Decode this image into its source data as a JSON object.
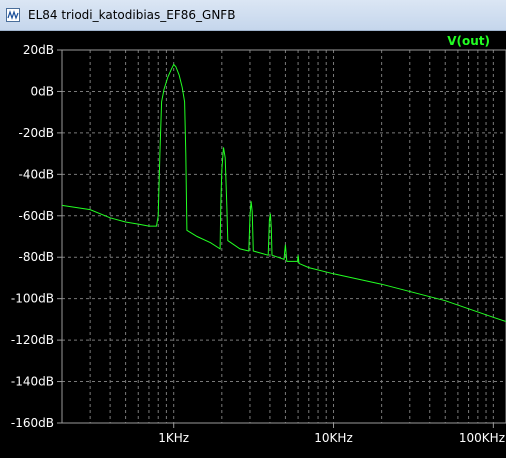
{
  "window": {
    "title": "EL84 triodi_katodibias_EF86_GNFB"
  },
  "chart_data": {
    "type": "line",
    "x_scale": "log",
    "xlim_hz": [
      200,
      120000
    ],
    "ylim_db": [
      -160,
      20
    ],
    "y_tick_values": [
      20,
      0,
      -20,
      -40,
      -60,
      -80,
      -100,
      -120,
      -140,
      -160
    ],
    "y_tick_labels": [
      "20dB",
      "0dB",
      "-20dB",
      "-40dB",
      "-60dB",
      "-80dB",
      "-100dB",
      "-120dB",
      "-140dB",
      "-160dB"
    ],
    "x_tick_values": [
      1000,
      10000,
      100000
    ],
    "x_tick_labels": [
      "1KHz",
      "10KHz",
      "100KHz"
    ],
    "grid": true,
    "colors": {
      "background": "#000000",
      "axes": "#9a9a9a",
      "grid": "#7a7a7a",
      "trace": "#22ff22"
    },
    "series": [
      {
        "name": "V(out)",
        "points": [
          [
            200,
            -55
          ],
          [
            300,
            -57
          ],
          [
            400,
            -61
          ],
          [
            500,
            -63
          ],
          [
            600,
            -64
          ],
          [
            700,
            -65
          ],
          [
            780,
            -65
          ],
          [
            800,
            -60
          ],
          [
            820,
            -30
          ],
          [
            840,
            -5
          ],
          [
            870,
            1
          ],
          [
            920,
            7
          ],
          [
            970,
            11
          ],
          [
            1000,
            13
          ],
          [
            1030,
            12
          ],
          [
            1080,
            8
          ],
          [
            1130,
            2
          ],
          [
            1170,
            -5
          ],
          [
            1190,
            -30
          ],
          [
            1210,
            -67
          ],
          [
            1400,
            -70
          ],
          [
            1700,
            -73
          ],
          [
            1950,
            -76
          ],
          [
            1970,
            -55
          ],
          [
            2000,
            -38
          ],
          [
            2050,
            -27
          ],
          [
            2100,
            -32
          ],
          [
            2150,
            -55
          ],
          [
            2180,
            -72
          ],
          [
            2600,
            -76
          ],
          [
            2950,
            -77
          ],
          [
            3000,
            -60
          ],
          [
            3050,
            -53
          ],
          [
            3100,
            -58
          ],
          [
            3150,
            -77
          ],
          [
            3900,
            -79
          ],
          [
            3970,
            -62
          ],
          [
            4030,
            -59
          ],
          [
            4080,
            -66
          ],
          [
            4120,
            -79
          ],
          [
            4900,
            -81
          ],
          [
            5000,
            -74
          ],
          [
            5100,
            -82
          ],
          [
            5950,
            -82
          ],
          [
            6000,
            -79
          ],
          [
            6080,
            -83
          ],
          [
            7000,
            -85
          ],
          [
            10000,
            -88
          ],
          [
            20000,
            -93
          ],
          [
            50000,
            -101
          ],
          [
            100000,
            -109
          ],
          [
            120000,
            -111
          ]
        ]
      }
    ]
  }
}
